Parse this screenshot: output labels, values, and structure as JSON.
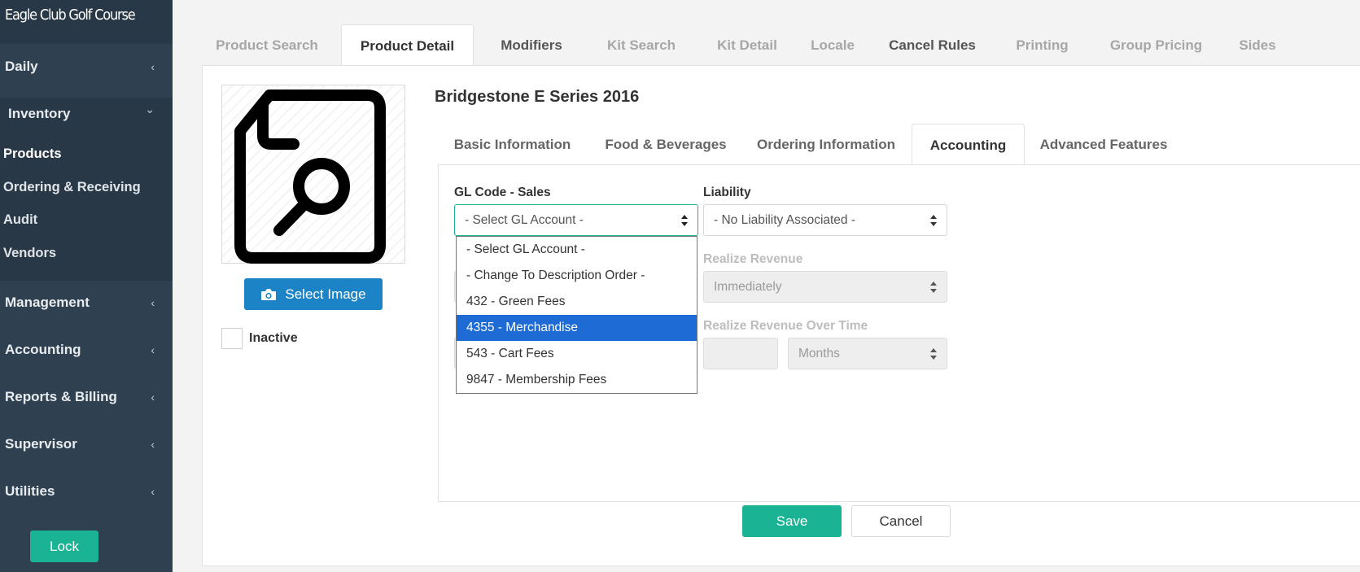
{
  "brand": {
    "title": "Eagle Club Golf Course"
  },
  "sidebar": {
    "items": [
      {
        "label": "Daily",
        "chevron": "‹"
      },
      {
        "label": "Inventory",
        "chevron": "⌄"
      },
      {
        "label": "Management",
        "chevron": "‹"
      },
      {
        "label": "Accounting",
        "chevron": "‹"
      },
      {
        "label": "Reports & Billing",
        "chevron": "‹"
      },
      {
        "label": "Supervisor",
        "chevron": "‹"
      },
      {
        "label": "Utilities",
        "chevron": "‹"
      }
    ],
    "subitems": [
      {
        "label": "Products"
      },
      {
        "label": "Ordering & Receiving"
      },
      {
        "label": "Audit"
      },
      {
        "label": "Vendors"
      }
    ],
    "lock_label": "Lock"
  },
  "top_tabs": [
    {
      "label": "Product Search"
    },
    {
      "label": "Product Detail"
    },
    {
      "label": "Modifiers"
    },
    {
      "label": "Kit Search"
    },
    {
      "label": "Kit Detail"
    },
    {
      "label": "Locale"
    },
    {
      "label": "Cancel Rules"
    },
    {
      "label": "Printing"
    },
    {
      "label": "Group Pricing"
    },
    {
      "label": "Sides"
    }
  ],
  "product": {
    "title": "Bridgestone E Series 2016",
    "select_image_label": "Select Image",
    "inactive_label": "Inactive"
  },
  "sub_tabs": [
    {
      "label": "Basic Information"
    },
    {
      "label": "Food & Beverages"
    },
    {
      "label": "Ordering Information"
    },
    {
      "label": "Accounting"
    },
    {
      "label": "Advanced Features"
    }
  ],
  "accounting": {
    "gl_code_sales_label": "GL Code - Sales",
    "gl_code_sales_value": "- Select GL Account -",
    "liability_label": "Liability",
    "liability_value": "- No Liability Associated -",
    "realize_revenue_label": "Realize Revenue",
    "realize_revenue_value": "Immediately",
    "realize_over_time_label": "Realize Revenue Over Time",
    "period_unit_value": "Months",
    "gl_options": [
      {
        "label": "- Select GL Account -"
      },
      {
        "label": "- Change To Description Order -"
      },
      {
        "label": "432 - Green Fees"
      },
      {
        "label": "4355 - Merchandise"
      },
      {
        "label": "543 - Cart Fees"
      },
      {
        "label": "9847 - Membership Fees"
      }
    ],
    "highlighted_option": "4355 - Merchandise"
  },
  "actions": {
    "save_label": "Save",
    "cancel_label": "Cancel"
  },
  "colors": {
    "sidebar_bg": "#2f4050",
    "accent_green": "#1ab394",
    "accent_blue": "#1c84c6",
    "dropdown_highlight": "#1e6bd6"
  }
}
